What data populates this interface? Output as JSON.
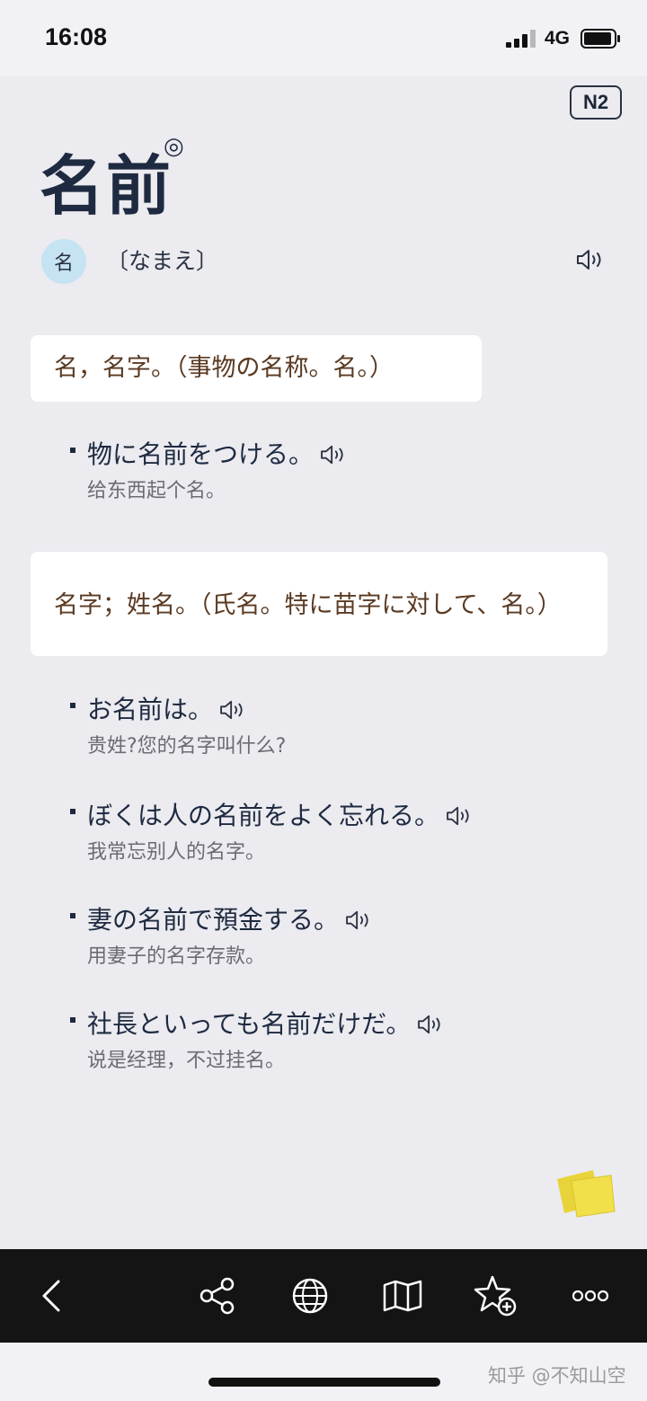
{
  "status_bar": {
    "time": "16:08",
    "network": "4G"
  },
  "entry": {
    "level": "N2",
    "word": "名前",
    "accent": "◎",
    "part_of_speech": "名",
    "reading": "〔なまえ〕"
  },
  "definitions": [
    {
      "text": "名，名字。（事物の名称。名。）",
      "examples": [
        {
          "jp": "物に名前をつける。",
          "cn": "给东西起个名。"
        }
      ]
    },
    {
      "text": "名字；姓名。（氏名。特に苗字に対して、名。）",
      "examples": [
        {
          "jp": "お名前は。",
          "cn": "贵姓?您的名字叫什么?"
        },
        {
          "jp": "ぼくは人の名前をよく忘れる。",
          "cn": "我常忘别人的名字。"
        },
        {
          "jp": "妻の名前で預金する。",
          "cn": "用妻子的名字存款。"
        },
        {
          "jp": "社長といっても名前だけだ。",
          "cn": "说是经理，不过挂名。"
        }
      ]
    }
  ],
  "toolbar": {
    "icons": [
      "back-icon",
      "share-icon",
      "globe-icon",
      "map-icon",
      "add-favorite-icon",
      "more-icon"
    ]
  },
  "watermark": "知乎 @不知山空"
}
